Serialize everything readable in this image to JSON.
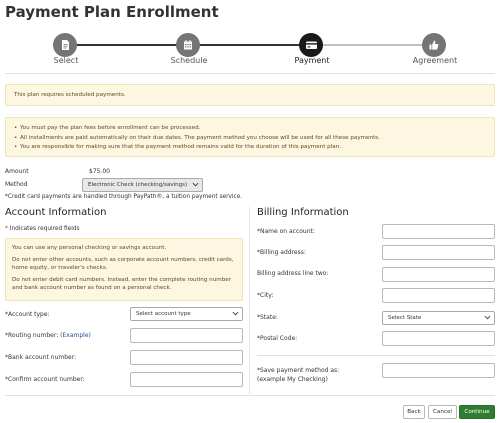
{
  "page": {
    "title": "Payment Plan Enrollment"
  },
  "steps": [
    {
      "label": "Select",
      "state": "complete",
      "icon": "document-icon"
    },
    {
      "label": "Schedule",
      "state": "complete",
      "icon": "calendar-icon"
    },
    {
      "label": "Payment",
      "state": "active",
      "icon": "credit-card-icon"
    },
    {
      "label": "Agreement",
      "state": "upcoming",
      "icon": "thumbs-up-icon"
    }
  ],
  "notices": {
    "scheduled": "This plan requires scheduled payments.",
    "rules": [
      "You must pay the plan fees before enrollment can be processed.",
      "All installments are paid automatically on their due dates. The payment method you choose will be used for all these payments.",
      "You are responsible for making sure that the payment method remains valid for the duration of this payment plan."
    ]
  },
  "payment": {
    "amount_label": "Amount",
    "amount_value": "$75.00",
    "method_label": "Method",
    "method_value": "Electronic Check (checking/savings)",
    "paypath_note": "*Credit card payments are handled through PayPath®, a tuition payment service."
  },
  "account": {
    "title": "Account Information",
    "required_note_star": "*",
    "required_note": " Indicates required fields",
    "warning": [
      "You can use any personal checking or savings account.",
      "Do not enter other accounts, such as corporate account numbers, credit cards, home equity, or traveler's checks.",
      "Do not enter debit card numbers. Instead, enter the complete routing number and bank account number as found on a personal check."
    ],
    "account_type_label": "*Account type:",
    "account_type_value": "Select account type",
    "routing_label": "*Routing number: ",
    "routing_example": "(Example)",
    "bank_account_label": "*Bank account number:",
    "confirm_account_label": "*Confirm account number:"
  },
  "billing": {
    "title": "Billing Information",
    "name_label": "*Name on account:",
    "address_label": "*Billing address:",
    "address2_label": "Billing address line two:",
    "city_label": "*City:",
    "state_label": "*State:",
    "state_value": "Select State",
    "postal_label": "*Postal Code:",
    "save_label_1": "*Save payment method as:",
    "save_label_2": "(example My Checking)"
  },
  "buttons": {
    "back": "Back",
    "cancel": "Cancel",
    "continue": "Continue"
  },
  "colors": {
    "primary": "#2e7d32",
    "notice_bg": "#fdf6e0",
    "step_active": "#1a1a1a",
    "step_done": "#757575"
  }
}
